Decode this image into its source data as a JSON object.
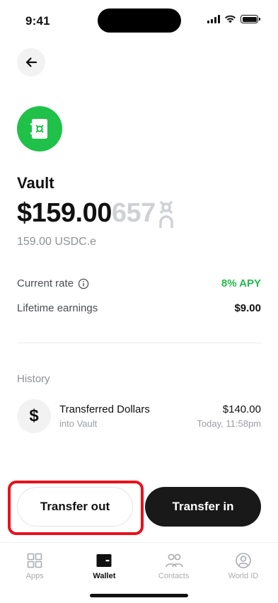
{
  "status_bar": {
    "time": "9:41"
  },
  "vault": {
    "title": "Vault",
    "balance_main": "$159.00",
    "balance_extra": "657",
    "balance_sub": "159.00 USDC.e",
    "brand_color": "#1fc148"
  },
  "stats": {
    "current_rate_label": "Current rate",
    "current_rate_value": "8% APY",
    "lifetime_label": "Lifetime earnings",
    "lifetime_value": "$9.00"
  },
  "history": {
    "title": "History",
    "items": [
      {
        "icon": "$",
        "title": "Transferred Dollars",
        "subtitle": "into Vault",
        "amount": "$140.00",
        "time": "Today, 11:58pm"
      }
    ]
  },
  "actions": {
    "transfer_out": "Transfer out",
    "transfer_in": "Transfer in",
    "highlight_color": "#e8111b"
  },
  "tabs": [
    {
      "label": "Apps",
      "icon": "apps-grid-icon",
      "active": false
    },
    {
      "label": "Wallet",
      "icon": "wallet-icon",
      "active": true
    },
    {
      "label": "Contacts",
      "icon": "contacts-icon",
      "active": false
    },
    {
      "label": "World ID",
      "icon": "world-id-icon",
      "active": false
    }
  ]
}
